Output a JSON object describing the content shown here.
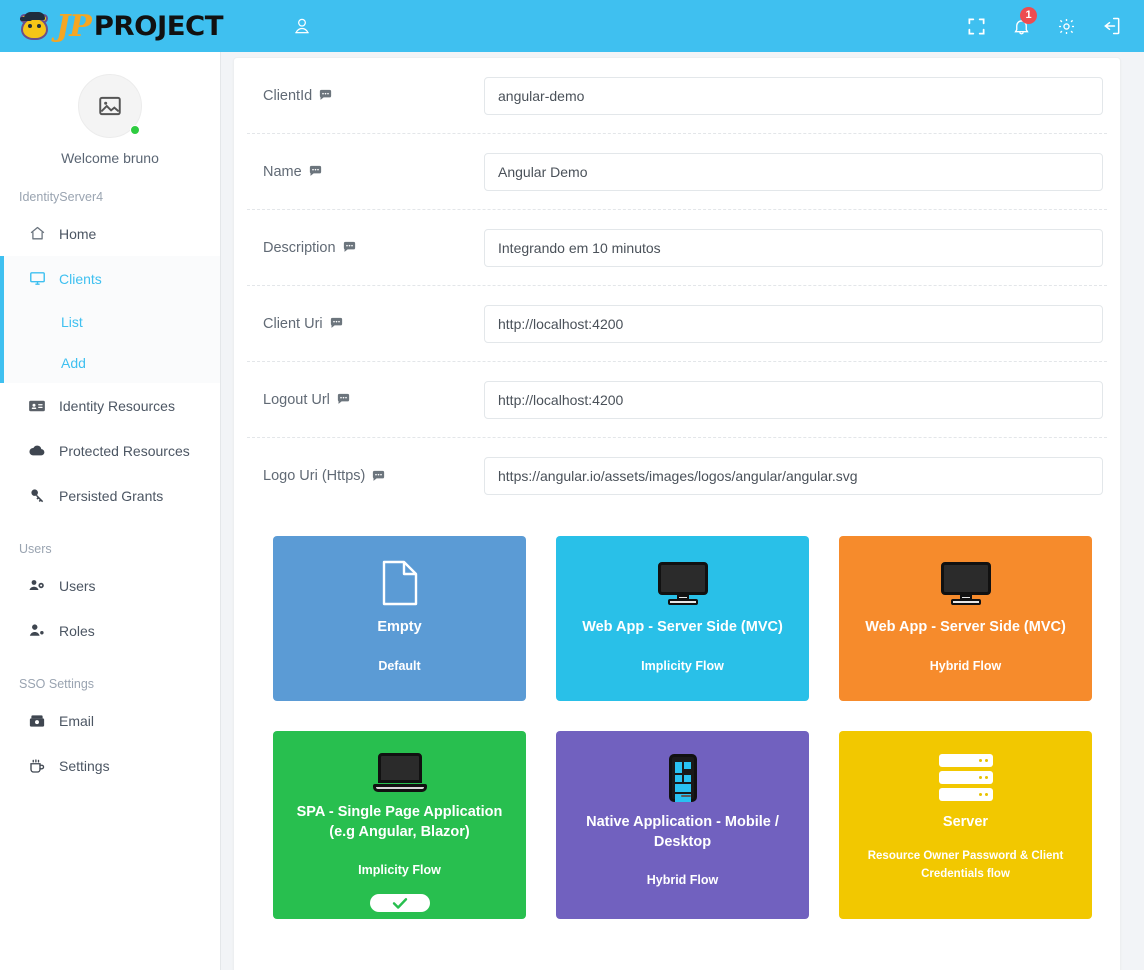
{
  "topbar": {
    "brand_jp": "JP",
    "brand_project": "PROJECT",
    "notification_count": "1",
    "icons": {
      "user": "user-icon",
      "fullscreen": "fullscreen-icon",
      "bell": "bell-icon",
      "gear": "gear-icon",
      "logout": "logout-icon"
    }
  },
  "sidebar": {
    "welcome": "Welcome bruno",
    "sections": [
      {
        "title": "IdentityServer4",
        "items": [
          {
            "label": "Home",
            "icon": "home-icon",
            "active": false,
            "sub": []
          },
          {
            "label": "Clients",
            "icon": "monitor-icon",
            "active": true,
            "sub": [
              {
                "label": "List"
              },
              {
                "label": "Add"
              }
            ]
          },
          {
            "label": "Identity Resources",
            "icon": "id-card-icon",
            "active": false,
            "sub": []
          },
          {
            "label": "Protected Resources",
            "icon": "cloud-icon",
            "active": false,
            "sub": []
          },
          {
            "label": "Persisted Grants",
            "icon": "key-icon",
            "active": false,
            "sub": []
          }
        ]
      },
      {
        "title": "Users",
        "items": [
          {
            "label": "Users",
            "icon": "users-cog-icon",
            "active": false,
            "sub": []
          },
          {
            "label": "Roles",
            "icon": "user-plus-icon",
            "active": false,
            "sub": []
          }
        ]
      },
      {
        "title": "SSO Settings",
        "items": [
          {
            "label": "Email",
            "icon": "mail-box-icon",
            "active": false,
            "sub": []
          },
          {
            "label": "Settings",
            "icon": "coffee-icon",
            "active": false,
            "sub": []
          }
        ]
      }
    ]
  },
  "form": {
    "rows": [
      {
        "label": "ClientId",
        "value": "angular-demo",
        "tip": "comment-icon"
      },
      {
        "label": "Name",
        "value": "Angular Demo",
        "tip": "comment-icon"
      },
      {
        "label": "Description",
        "value": "Integrando em 10 minutos",
        "tip": "comment-icon"
      },
      {
        "label": "Client Uri",
        "value": "http://localhost:4200",
        "tip": "comment-icon"
      },
      {
        "label": "Logout Url",
        "value": "http://localhost:4200",
        "tip": "comment-icon"
      },
      {
        "label": "Logo Uri (Https)",
        "value": "https://angular.io/assets/images/logos/angular/angular.svg",
        "tip": "comment-icon"
      }
    ]
  },
  "tiles": [
    {
      "title": "Empty",
      "subtitle": "Default",
      "icon": "file-icon",
      "color": "#5b9bd5",
      "selected": false,
      "row": 1
    },
    {
      "title": "Web App - Server Side (MVC)",
      "subtitle": "Implicity Flow",
      "icon": "monitor-icon",
      "color": "#29c0e8",
      "selected": false,
      "row": 1
    },
    {
      "title": "Web App - Server Side (MVC)",
      "subtitle": "Hybrid Flow",
      "icon": "monitor-icon",
      "color": "#f68b2c",
      "selected": false,
      "row": 1
    },
    {
      "title": "SPA - Single Page Application (e.g Angular, Blazor)",
      "subtitle": "Implicity Flow",
      "icon": "laptop-icon",
      "color": "#28bf4f",
      "selected": true,
      "row": 2
    },
    {
      "title": "Native Application - Mobile / Desktop",
      "subtitle": "Hybrid Flow",
      "icon": "phone-icon",
      "color": "#7161bf",
      "selected": false,
      "row": 2
    },
    {
      "title": "Server",
      "subtitle": "Resource Owner Password & Client Credentials flow",
      "icon": "server-icon",
      "color": "#f2c800",
      "selected": false,
      "row": 2
    }
  ],
  "colors": {
    "accent": "#3fc0f0",
    "badge": "#ed4c50",
    "online": "#2ecc40"
  }
}
